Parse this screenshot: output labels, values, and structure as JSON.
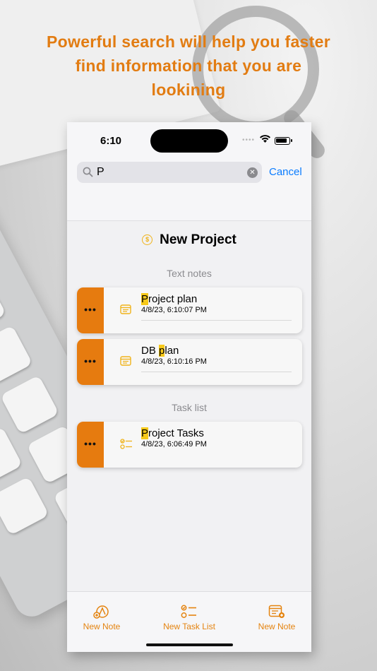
{
  "promo": {
    "headline_lines": [
      "Powerful search will help you faster",
      "find information that you are",
      "lookining"
    ]
  },
  "status_bar": {
    "time": "6:10"
  },
  "search": {
    "query": "P",
    "cancel_label": "Cancel",
    "clear_icon": "x-circle-icon"
  },
  "project": {
    "title": "New Project",
    "icon": "coin-icon"
  },
  "sections": {
    "text_notes": {
      "label": "Text notes",
      "items": [
        {
          "title_highlight": "P",
          "title_before": "",
          "title_rest": "roject plan",
          "date": "4/8/23, 6:10:07 PM",
          "action": "•••"
        },
        {
          "title_before": "DB ",
          "title_highlight": "p",
          "title_rest": "lan",
          "date": "4/8/23, 6:10:16 PM",
          "action": "•••"
        }
      ]
    },
    "task_list": {
      "label": "Task list",
      "items": [
        {
          "title_before": "",
          "title_highlight": "P",
          "title_rest": "roject Tasks",
          "date": "4/8/23, 6:06:49 PM",
          "action": "•••"
        }
      ]
    }
  },
  "tabbar": {
    "items": [
      {
        "label": "New Note",
        "icon": "new-sketch-note-icon"
      },
      {
        "label": "New Task List",
        "icon": "task-list-icon"
      },
      {
        "label": "New Note",
        "icon": "new-text-note-icon"
      }
    ]
  },
  "colors": {
    "accent": "#e67b0f",
    "highlight": "#f7c919",
    "link": "#0a7cff"
  }
}
